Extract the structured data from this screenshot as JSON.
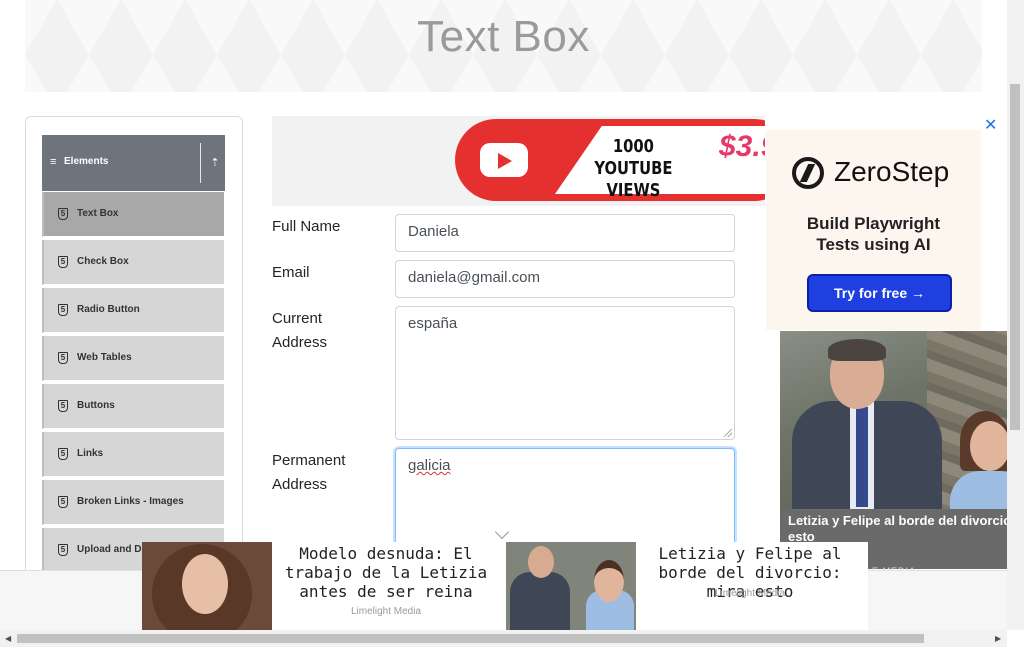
{
  "page": {
    "title": "Text Box"
  },
  "sidebar": {
    "group": {
      "label": "Elements",
      "menu_glyph": "≡",
      "toggle_glyph": "⇡"
    },
    "items": [
      {
        "label": "Text Box",
        "active": true
      },
      {
        "label": "Check Box"
      },
      {
        "label": "Radio Button"
      },
      {
        "label": "Web Tables"
      },
      {
        "label": "Buttons"
      },
      {
        "label": "Links"
      },
      {
        "label": "Broken Links - Images"
      },
      {
        "label": "Upload and D"
      }
    ]
  },
  "promo": {
    "line1": "1000",
    "line2": "YOUTUBE VIEWS",
    "price": "$3.9"
  },
  "form": {
    "full_name": {
      "label": "Full Name",
      "value": "Daniela"
    },
    "email": {
      "label": "Email",
      "value": "daniela@gmail.com"
    },
    "current_address": {
      "label_line1": "Current",
      "label_line2": "Address",
      "value": "españa"
    },
    "permanent_address": {
      "label_line1": "Permanent",
      "label_line2": "Address",
      "value": "galicia"
    }
  },
  "right_ad": {
    "close": "✕",
    "brand": "ZeroStep",
    "tagline_line1": "Build Playwright",
    "tagline_line2": "Tests using AI",
    "cta": "Try for free →",
    "news_caption": "Letizia y Felipe al borde del divorcio: mira esto",
    "news_source": "E MEDIA"
  },
  "sticky_ad": {
    "story1": {
      "headline": "Modelo desnuda: El trabajo de la Letizia antes de ser reina",
      "source": "Limelight Media"
    },
    "story2": {
      "headline": "Letizia y Felipe al borde del divorcio: mira esto",
      "source": "Limelight Media"
    }
  },
  "scroll": {
    "left_arrow": "◀",
    "right_arrow": "▶"
  }
}
